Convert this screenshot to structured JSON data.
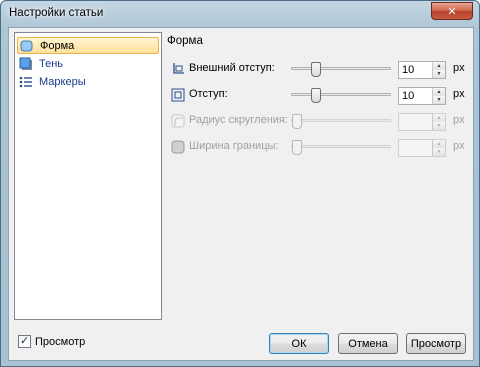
{
  "window": {
    "title": "Настройки статьи",
    "close_glyph": "✕"
  },
  "nav": {
    "items": [
      {
        "label": "Форма",
        "icon": "shape-icon",
        "selected": true
      },
      {
        "label": "Тень",
        "icon": "shadow-icon",
        "selected": false
      },
      {
        "label": "Маркеры",
        "icon": "bullets-icon",
        "selected": false
      }
    ]
  },
  "section": {
    "title": "Форма"
  },
  "settings": [
    {
      "label": "Внешний отступ:",
      "value": "10",
      "unit": "px",
      "slider_fraction": 0.22,
      "enabled": true,
      "icon": "margin-icon"
    },
    {
      "label": "Отступ:",
      "value": "10",
      "unit": "px",
      "slider_fraction": 0.22,
      "enabled": true,
      "icon": "padding-icon"
    },
    {
      "label": "Радиус скругления:",
      "value": "",
      "unit": "px",
      "slider_fraction": 0.0,
      "enabled": false,
      "icon": "corner-radius-icon"
    },
    {
      "label": "Ширина границы:",
      "value": "",
      "unit": "px",
      "slider_fraction": 0.0,
      "enabled": false,
      "icon": "border-width-icon"
    }
  ],
  "footer": {
    "preview_checkbox": {
      "label": "Просмотр",
      "checked": true
    },
    "buttons": {
      "ok": "ОК",
      "cancel": "Отмена",
      "preview": "Просмотр"
    }
  }
}
